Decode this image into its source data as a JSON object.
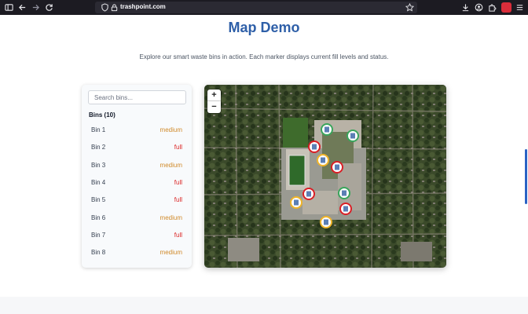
{
  "browser": {
    "url": "trashpoint.com"
  },
  "page": {
    "title": "Map Demo",
    "subtitle": "Explore our smart waste bins in action. Each marker displays current fill levels and status."
  },
  "sidebar": {
    "search_placeholder": "Search bins...",
    "heading": "Bins (10)",
    "bins": [
      {
        "name": "Bin 1",
        "status": "medium"
      },
      {
        "name": "Bin 2",
        "status": "full"
      },
      {
        "name": "Bin 3",
        "status": "medium"
      },
      {
        "name": "Bin 4",
        "status": "full"
      },
      {
        "name": "Bin 5",
        "status": "full"
      },
      {
        "name": "Bin 6",
        "status": "medium"
      },
      {
        "name": "Bin 7",
        "status": "full"
      },
      {
        "name": "Bin 8",
        "status": "medium"
      }
    ]
  },
  "map": {
    "zoom_in": "+",
    "zoom_out": "−",
    "marker_colors": {
      "full": "#d91f26",
      "medium": "#f0b429",
      "empty": "#3aa55c"
    }
  },
  "colors": {
    "accent": "#2e5fa8",
    "medium": "#d08a2a",
    "full": "#dc2626"
  }
}
